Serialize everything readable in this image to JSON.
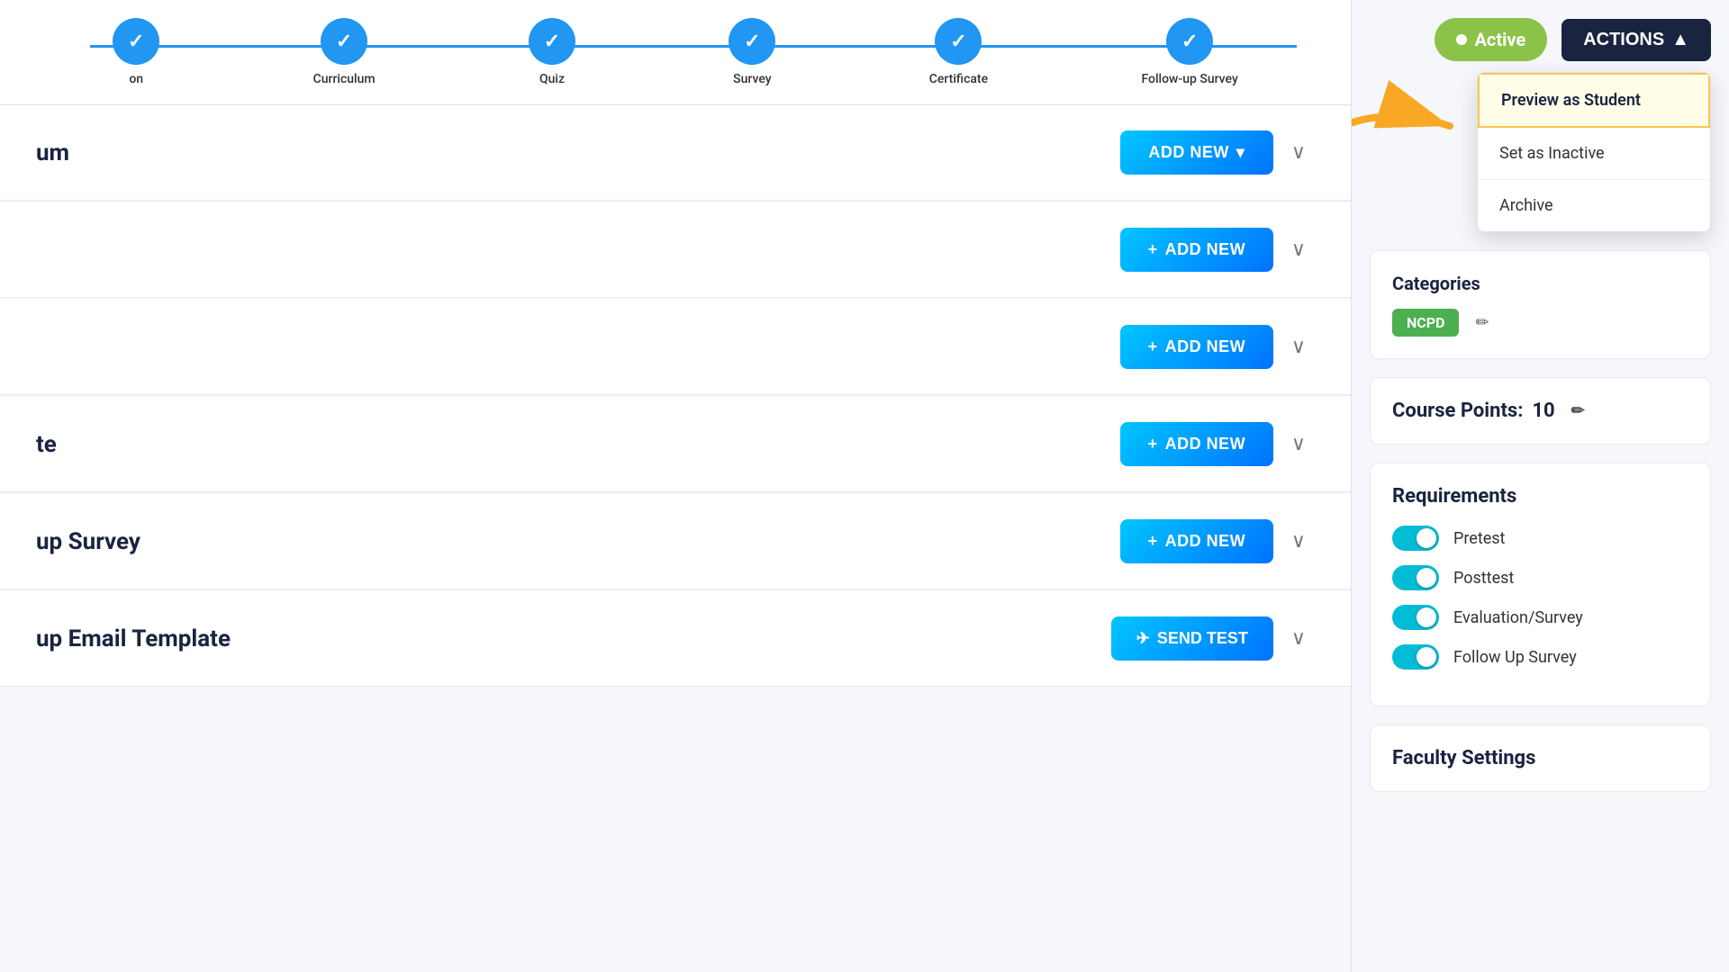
{
  "stepper": {
    "steps": [
      {
        "label": "on",
        "completed": true
      },
      {
        "label": "Curriculum",
        "completed": true
      },
      {
        "label": "Quiz",
        "completed": true
      },
      {
        "label": "Survey",
        "completed": true
      },
      {
        "label": "Certificate",
        "completed": true
      },
      {
        "label": "Follow-up Survey",
        "completed": true
      }
    ]
  },
  "sections": [
    {
      "id": "curriculum",
      "title": "um",
      "button_type": "add_new_no_plus",
      "button_label": "ADD NEW",
      "has_chevron": true
    },
    {
      "id": "quiz",
      "title": "",
      "button_type": "add_new",
      "button_label": "ADD NEW",
      "has_chevron": true
    },
    {
      "id": "survey",
      "title": "",
      "button_type": "add_new",
      "button_label": "ADD NEW",
      "has_chevron": true
    },
    {
      "id": "certificate",
      "title": "te",
      "button_type": "add_new",
      "button_label": "ADD NEW",
      "has_chevron": true
    },
    {
      "id": "followup_survey",
      "title": "up Survey",
      "button_type": "add_new",
      "button_label": "ADD NEW",
      "has_chevron": true
    },
    {
      "id": "followup_email",
      "title": "up Email Template",
      "button_type": "send_test",
      "button_label": "SEND TEST",
      "has_chevron": true
    }
  ],
  "header": {
    "active_label": "Active",
    "actions_label": "ACTIONS"
  },
  "dropdown": {
    "items": [
      {
        "id": "preview",
        "label": "Preview as Student",
        "highlighted": true
      },
      {
        "id": "inactive",
        "label": "Set as Inactive",
        "highlighted": false
      },
      {
        "id": "archive",
        "label": "Archive",
        "highlighted": false
      }
    ]
  },
  "sidebar": {
    "categories_title": "Categories",
    "category_tag": "NCPD",
    "course_points_label": "Course Points:",
    "course_points_value": "10",
    "requirements_title": "Requirements",
    "requirements": [
      {
        "label": "Pretest",
        "enabled": true
      },
      {
        "label": "Posttest",
        "enabled": true
      },
      {
        "label": "Evaluation/Survey",
        "enabled": true
      },
      {
        "label": "Follow Up Survey",
        "enabled": true
      }
    ],
    "faculty_title": "Faculty Settings"
  }
}
